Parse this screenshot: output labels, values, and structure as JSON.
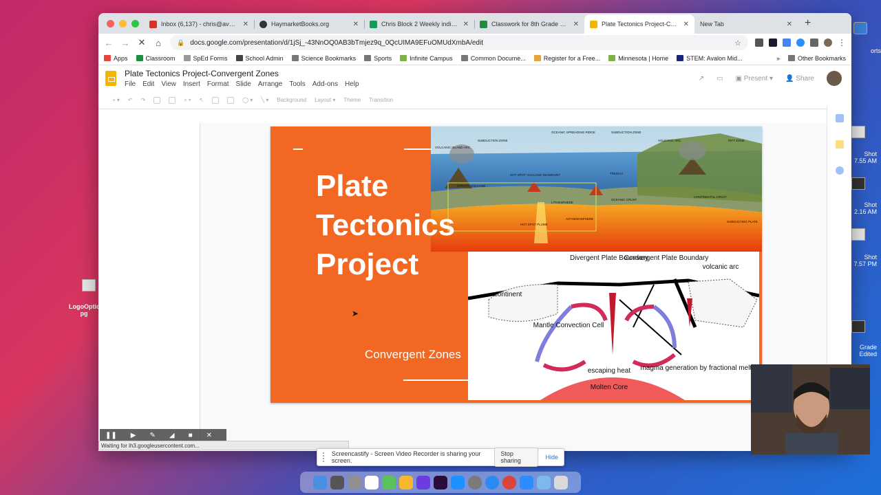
{
  "browser": {
    "tabs": [
      {
        "title": "Inbox (6,137) - chris@avalonsc",
        "fav": "#d93025",
        "icon": "gmail-icon"
      },
      {
        "title": "HaymarketBooks.org",
        "fav": "#333333",
        "icon": "github-icon"
      },
      {
        "title": "Chris Block 2 Weekly individu",
        "fav": "#0f9d58",
        "icon": "sheets-icon"
      },
      {
        "title": "Classwork for 8th Grade Earth",
        "fav": "#1e8e3e",
        "icon": "classroom-icon"
      },
      {
        "title": "Plate Tectonics Project-Conve",
        "fav": "#f4b400",
        "icon": "slides-icon",
        "active": true
      },
      {
        "title": "New Tab",
        "fav": "",
        "icon": "",
        "active": false
      }
    ],
    "url": "docs.google.com/presentation/d/1jSj_-43NnOQ0AB3bTmjez9q_0QcUIMA9EFuOMUdXmbA/edit",
    "bookmarks": [
      {
        "label": "Apps",
        "color": "#e8453c"
      },
      {
        "label": "Classroom",
        "color": "#1e8e3e"
      },
      {
        "label": "SpEd Forms",
        "color": "#999999"
      },
      {
        "label": "School Admin",
        "color": "#444444"
      },
      {
        "label": "Science Bookmarks",
        "color": "#777777"
      },
      {
        "label": "Sports",
        "color": "#777777"
      },
      {
        "label": "Infinite Campus",
        "color": "#7cb342"
      },
      {
        "label": "Common Docume...",
        "color": "#777777"
      },
      {
        "label": "Register for a Free...",
        "color": "#e8a33c"
      },
      {
        "label": "Minnesota | Home",
        "color": "#7cb342"
      },
      {
        "label": "STEM: Avalon Mid...",
        "color": "#1a237e"
      }
    ],
    "overflow": "»",
    "other_bookmarks": "Other Bookmarks",
    "status_text": "Waiting for lh3.googleusercontent.com..."
  },
  "slides_app": {
    "title": "Plate Tectonics Project-Convergent Zones",
    "menus": [
      "File",
      "Edit",
      "View",
      "Insert",
      "Format",
      "Slide",
      "Arrange",
      "Tools",
      "Add-ons",
      "Help"
    ],
    "present_label": "Present",
    "share_label": "Share",
    "toolbar": {
      "background": "Background",
      "layout": "Layout",
      "theme": "Theme",
      "transition": "Transition"
    }
  },
  "slide": {
    "title": "Plate\nTectonics\nProject",
    "subtitle": "Convergent Zones",
    "bg_color": "#f26722",
    "top_image_labels": [
      "VOLCANIC ISLAND ARC",
      "SUBDUCTION ZONE",
      "OCEANIC SPREADING RIDGE",
      "SUBDUCTION ZONE",
      "VOLCANIC ARC",
      "RIFT ZONE",
      "HOT SPOT VOLCANO SEAMOUNT",
      "STRATO-VOLCANO",
      "TRENCH",
      "LITHOSPHERE",
      "OCEANIC CRUST",
      "CONTINENTAL CRUST",
      "ASTHENOSPHERE",
      "HOT SPOT PLUME",
      "SUBDUCTING PLATE"
    ],
    "diagram_labels": {
      "divergent": "Divergent Plate Boundary",
      "convergent": "Convergent Plate Boundary",
      "volcanic_arc": "volcanic arc",
      "continent": "continent",
      "mantle": "Mantle Convection Cell",
      "heat": "escaping heat",
      "magma": "magma generation by fractional melting",
      "core": "Molten Core"
    }
  },
  "screencastify": {
    "message": "Screencastify - Screen Video Recorder is sharing your screen.",
    "stop_label": "Stop sharing",
    "hide_label": "Hide"
  },
  "desktop": {
    "left_icon_label": "LogoOptic... pg",
    "right_labels": [
      "orts",
      "Shot 7.55 AM",
      "Shot 2.16 AM",
      "Shot 7.57 PM",
      "Grade Edited"
    ]
  }
}
